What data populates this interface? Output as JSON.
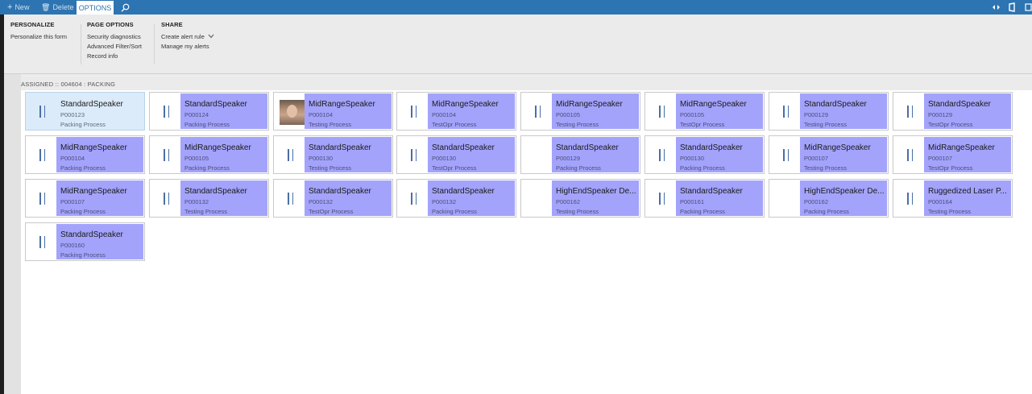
{
  "toolbar": {
    "new_label": "New",
    "delete_label": "Delete",
    "options_tab": "OPTIONS"
  },
  "ribbon": {
    "personalize": {
      "title": "PERSONALIZE",
      "items": [
        "Personalize this form"
      ]
    },
    "page_options": {
      "title": "PAGE OPTIONS",
      "items": [
        "Security diagnostics",
        "Advanced Filter/Sort",
        "Record info"
      ]
    },
    "share": {
      "title": "SHARE",
      "items": [
        "Create alert rule",
        "Manage my alerts"
      ]
    }
  },
  "breadcrumb": "ASSIGNED :: 004604 : PACKING",
  "colors": {
    "accent": "#2d74b2",
    "tile_fill": "#a3a3fc",
    "selected_tile": "#dcebf9"
  },
  "tiles": [
    {
      "name": "StandardSpeaker",
      "code": "P000123",
      "process": "Packing Process",
      "icon": "pause-icon",
      "selected": true
    },
    {
      "name": "StandardSpeaker",
      "code": "P000124",
      "process": "Packing Process",
      "icon": "pause-icon"
    },
    {
      "name": "MidRangeSpeaker",
      "code": "P000104",
      "process": "Testing Process",
      "icon": "worker-photo"
    },
    {
      "name": "MidRangeSpeaker",
      "code": "P000104",
      "process": "TestOpr Process",
      "icon": "pause-icon"
    },
    {
      "name": "MidRangeSpeaker",
      "code": "P000105",
      "process": "Testing Process",
      "icon": "pause-icon"
    },
    {
      "name": "MidRangeSpeaker",
      "code": "P000105",
      "process": "TestOpr Process",
      "icon": "pause-icon"
    },
    {
      "name": "StandardSpeaker",
      "code": "P000129",
      "process": "Testing Process",
      "icon": "pause-icon"
    },
    {
      "name": "StandardSpeaker",
      "code": "P000129",
      "process": "TestOpr Process",
      "icon": "pause-icon"
    },
    {
      "name": "MidRangeSpeaker",
      "code": "P000104",
      "process": "Packing Process",
      "icon": "pause-icon"
    },
    {
      "name": "MidRangeSpeaker",
      "code": "P000105",
      "process": "Packing Process",
      "icon": "pause-icon"
    },
    {
      "name": "StandardSpeaker",
      "code": "P000130",
      "process": "Testing Process",
      "icon": "pause-icon"
    },
    {
      "name": "StandardSpeaker",
      "code": "P000130",
      "process": "TestOpr Process",
      "icon": "pause-icon"
    },
    {
      "name": "StandardSpeaker",
      "code": "P000129",
      "process": "Packing Process",
      "icon": "none"
    },
    {
      "name": "StandardSpeaker",
      "code": "P000130",
      "process": "Packing Process",
      "icon": "pause-icon"
    },
    {
      "name": "MidRangeSpeaker",
      "code": "P000107",
      "process": "Testing Process",
      "icon": "pause-icon"
    },
    {
      "name": "MidRangeSpeaker",
      "code": "P000107",
      "process": "TestOpr Process",
      "icon": "pause-icon"
    },
    {
      "name": "MidRangeSpeaker",
      "code": "P000107",
      "process": "Packing Process",
      "icon": "pause-icon"
    },
    {
      "name": "StandardSpeaker",
      "code": "P000132",
      "process": "Testing Process",
      "icon": "pause-icon"
    },
    {
      "name": "StandardSpeaker",
      "code": "P000132",
      "process": "TestOpr Process",
      "icon": "pause-icon"
    },
    {
      "name": "StandardSpeaker",
      "code": "P000132",
      "process": "Packing Process",
      "icon": "pause-icon"
    },
    {
      "name": "HighEndSpeaker De...",
      "code": "P000162",
      "process": "Testing Process",
      "icon": "none"
    },
    {
      "name": "StandardSpeaker",
      "code": "P000161",
      "process": "Packing Process",
      "icon": "pause-icon"
    },
    {
      "name": "HighEndSpeaker De...",
      "code": "P000162",
      "process": "Packing Process",
      "icon": "none"
    },
    {
      "name": "Ruggedized Laser P...",
      "code": "P000164",
      "process": "Testing Process",
      "icon": "pause-icon"
    },
    {
      "name": "StandardSpeaker",
      "code": "P000160",
      "process": "Packing Process",
      "icon": "pause-icon"
    }
  ]
}
